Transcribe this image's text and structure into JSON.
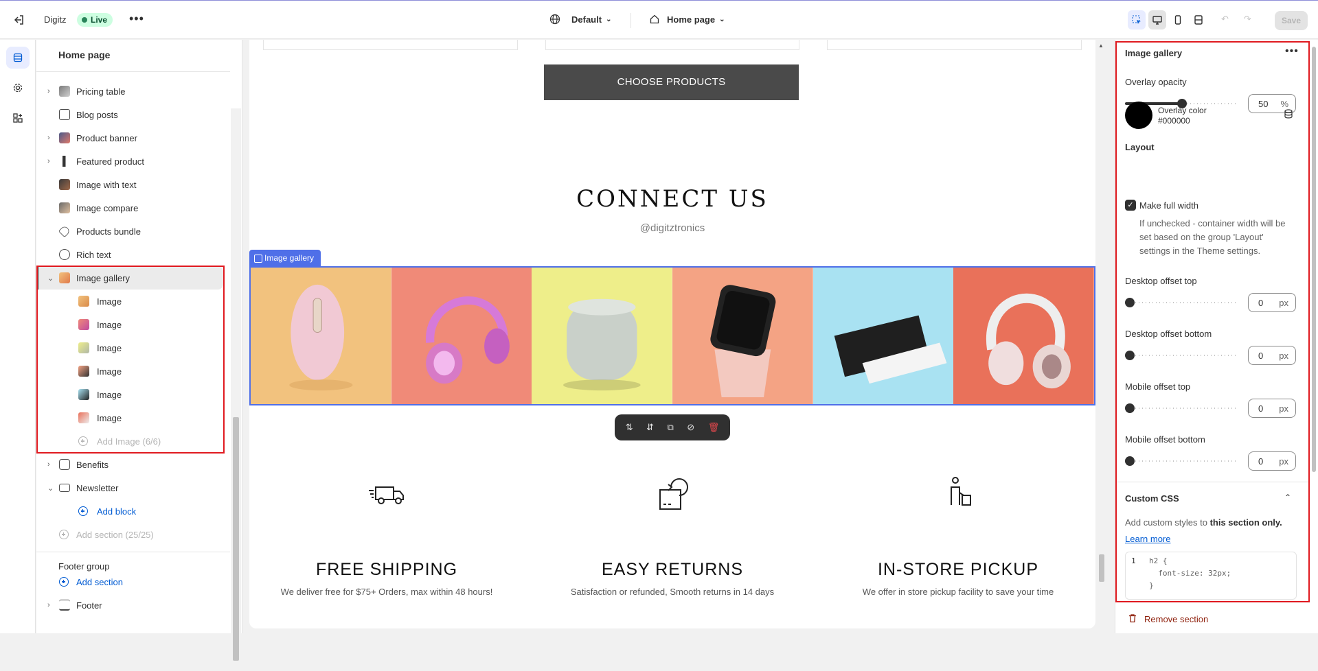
{
  "topbar": {
    "store_name": "Digitz",
    "status_badge": "Live",
    "theme_selector": "Default",
    "page_selector": "Home page",
    "save_label": "Save"
  },
  "sidebar": {
    "title": "Home page",
    "items": [
      {
        "label": "Pricing table",
        "chevron": "right",
        "icon": "pricing-icon"
      },
      {
        "label": "Blog posts",
        "chevron": "",
        "icon": "blog-icon"
      },
      {
        "label": "Product banner",
        "chevron": "right",
        "icon": "banner-icon"
      },
      {
        "label": "Featured product",
        "chevron": "right",
        "icon": "featured-icon"
      },
      {
        "label": "Image with text",
        "chevron": "",
        "icon": "image-text-icon"
      },
      {
        "label": "Image compare",
        "chevron": "",
        "icon": "compare-icon"
      },
      {
        "label": "Products bundle",
        "chevron": "",
        "icon": "tag-icon"
      },
      {
        "label": "Rich text",
        "chevron": "",
        "icon": "text-icon"
      },
      {
        "label": "Image gallery",
        "chevron": "down",
        "icon": "gallery-icon",
        "selected": true
      }
    ],
    "gallery_children": [
      "Image",
      "Image",
      "Image",
      "Image",
      "Image",
      "Image"
    ],
    "add_image_label": "Add Image (6/6)",
    "benefits_label": "Benefits",
    "newsletter_label": "Newsletter",
    "add_block_label": "Add block",
    "add_section_label": "Add section (25/25)",
    "footer_group_label": "Footer group",
    "footer_add_section_label": "Add section",
    "footer_label": "Footer"
  },
  "canvas": {
    "choose_button": "CHOOSE PRODUCTS",
    "connect_title": "CONNECT US",
    "connect_handle": "@digitztronics",
    "gallery_tag": "Image gallery",
    "gallery_tiles": [
      {
        "bg": "#f2c27e",
        "subject": "mouse"
      },
      {
        "bg": "#f08a78",
        "subject": "headphones-pink"
      },
      {
        "bg": "#eeee8a",
        "subject": "speaker"
      },
      {
        "bg": "#f4a384",
        "subject": "smartwatch"
      },
      {
        "bg": "#a9e2f2",
        "subject": "powerbank"
      },
      {
        "bg": "#e9715a",
        "subject": "headphones-white"
      }
    ],
    "features": [
      {
        "title": "FREE SHIPPING",
        "desc": "We deliver free for $75+ Orders, max within 48 hours!"
      },
      {
        "title": "EASY RETURNS",
        "desc": "Satisfaction or refunded, Smooth returns in 14 days"
      },
      {
        "title": "IN-STORE PICKUP",
        "desc": "We offer in store pickup facility to save your time"
      }
    ]
  },
  "panel": {
    "title": "Image gallery",
    "overlay_opacity_label": "Overlay opacity",
    "overlay_opacity_value": "50",
    "overlay_opacity_unit": "%",
    "overlay_opacity_level": 0.5,
    "overlay_color_label": "Overlay color",
    "overlay_color_value": "#000000",
    "layout_heading": "Layout",
    "full_width_label": "Make full width",
    "full_width_checked": true,
    "full_width_help": "If unchecked - container width will be set based on the group 'Layout' settings in the Theme settings.",
    "desktop_offset_top_label": "Desktop offset top",
    "desktop_offset_top_value": "0",
    "desktop_offset_bottom_label": "Desktop offset bottom",
    "desktop_offset_bottom_value": "0",
    "mobile_offset_top_label": "Mobile offset top",
    "mobile_offset_top_value": "0",
    "mobile_offset_bottom_label": "Mobile offset bottom",
    "mobile_offset_bottom_value": "0",
    "px_unit": "px",
    "custom_css_heading": "Custom CSS",
    "custom_css_help_1": "Add custom styles to ",
    "custom_css_help_bold": "this section only.",
    "learn_more": "Learn more",
    "code_line_no": "1",
    "code_text": "h2 {\n  font-size: 32px;\n}",
    "remove_section": "Remove section"
  },
  "colors": {
    "accent_blue": "#4f6fe8",
    "highlight_red": "#e0191f",
    "live_green": "#cdfee1"
  }
}
